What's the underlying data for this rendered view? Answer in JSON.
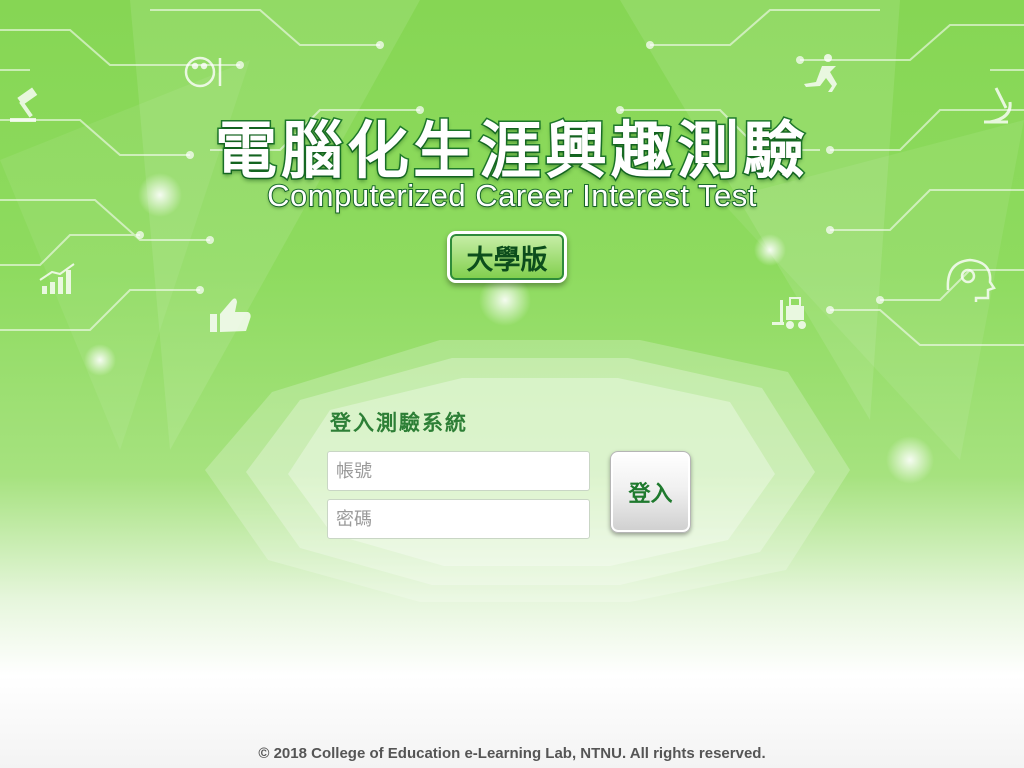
{
  "colors": {
    "background_green": "#8edb5f",
    "title_stroke": "#1e7a2c",
    "accent_green": "#2d7f36",
    "button_text": "#1f7a2e"
  },
  "header": {
    "title_cn": "電腦化生涯興趣測驗",
    "title_en": "Computerized Career Interest Test",
    "edition": "大學版"
  },
  "decor_icons": [
    "palette-icon",
    "gavel-icon",
    "bar-chart-icon",
    "thumbs-up-icon",
    "runner-icon",
    "microscope-icon",
    "brain-head-icon",
    "forklift-icon"
  ],
  "login": {
    "title": "登入測驗系統",
    "username_placeholder": "帳號",
    "username_value": "",
    "password_placeholder": "密碼",
    "password_value": "",
    "submit_label": "登入"
  },
  "footer": {
    "copyright": "© 2018 College of Education e-Learning Lab, NTNU. All rights reserved."
  }
}
